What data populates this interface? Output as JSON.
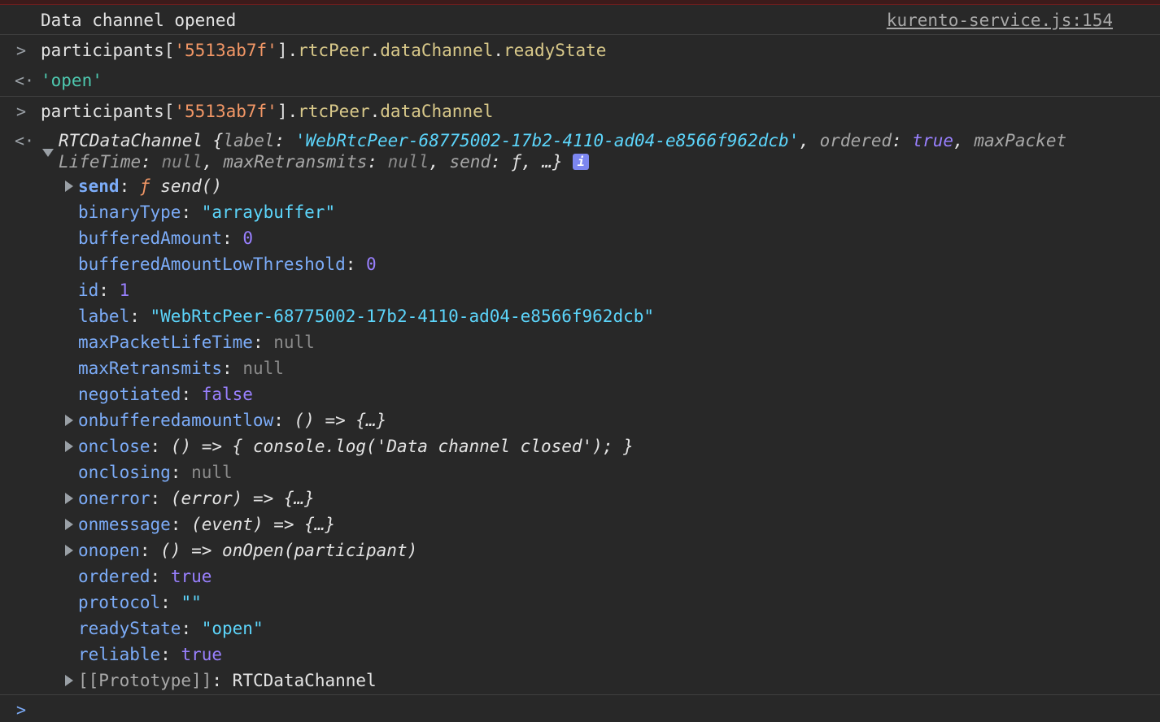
{
  "log": {
    "message": "Data channel opened",
    "source_link": "kurento-service.js:154"
  },
  "cmd1": {
    "object": "participants[",
    "id_str": "'5513ab7f'",
    "close": "].",
    "p1": "rtcPeer",
    "dot": ".",
    "p2": "dataChannel",
    "p3": "readyState",
    "result": "'open'"
  },
  "cmd2": {
    "object": "participants[",
    "id_str": "'5513ab7f'",
    "close": "].",
    "p1": "rtcPeer",
    "dot": ".",
    "p2": "dataChannel"
  },
  "summary": {
    "class_name": "RTCDataChannel",
    "open_brace": " {",
    "k_label": "label",
    "v_label": "'WebRtcPeer-68775002-17b2-4110-ad04-e8566f962dcb'",
    "k_ordered": "ordered",
    "v_ordered": "true",
    "k_maxpacket1": "maxPacket",
    "k_maxpacket2": "LifeTime",
    "v_maxpacket": "null",
    "k_maxretrans": "maxRetransmits",
    "v_maxretrans": "null",
    "k_send": "send",
    "v_send": "ƒ",
    "ellipsis": "…}",
    "info_icon": "i"
  },
  "properties": [
    {
      "key": "send",
      "value": "send()",
      "fprefix": "ƒ"
    },
    {
      "key": "binaryType",
      "value": "\"arraybuffer\""
    },
    {
      "key": "bufferedAmount",
      "value": "0"
    },
    {
      "key": "bufferedAmountLowThreshold",
      "value": "0"
    },
    {
      "key": "id",
      "value": "1"
    },
    {
      "key": "label",
      "value": "\"WebRtcPeer-68775002-17b2-4110-ad04-e8566f962dcb\""
    },
    {
      "key": "maxPacketLifeTime",
      "value": "null"
    },
    {
      "key": "maxRetransmits",
      "value": "null"
    },
    {
      "key": "negotiated",
      "value": "false"
    },
    {
      "key": "onbufferedamountlow",
      "value": "() => {…}"
    },
    {
      "key": "onclose",
      "value": "() => { console.log('Data channel closed'); }"
    },
    {
      "key": "onclosing",
      "value": "null"
    },
    {
      "key": "onerror",
      "value": "(error) => {…}"
    },
    {
      "key": "onmessage",
      "value": "(event) => {…}"
    },
    {
      "key": "onopen",
      "value": "() => onOpen(participant)"
    },
    {
      "key": "ordered",
      "value": "true"
    },
    {
      "key": "protocol",
      "value": "\"\""
    },
    {
      "key": "readyState",
      "value": "\"open\""
    },
    {
      "key": "reliable",
      "value": "true"
    },
    {
      "key": "[[Prototype]]",
      "value": "RTCDataChannel"
    }
  ],
  "colon": ": ",
  "icons": {
    "prompt": "chevron-right-icon",
    "result": "result-arrow-icon",
    "expand": "triangle-right-icon",
    "collapse": "triangle-down-icon",
    "info": "info-icon"
  },
  "colors": {
    "background": "#282828",
    "string": "#f29766",
    "property": "#7cacf8",
    "number": "#9980ff",
    "teal_string": "#5cd5fb"
  }
}
